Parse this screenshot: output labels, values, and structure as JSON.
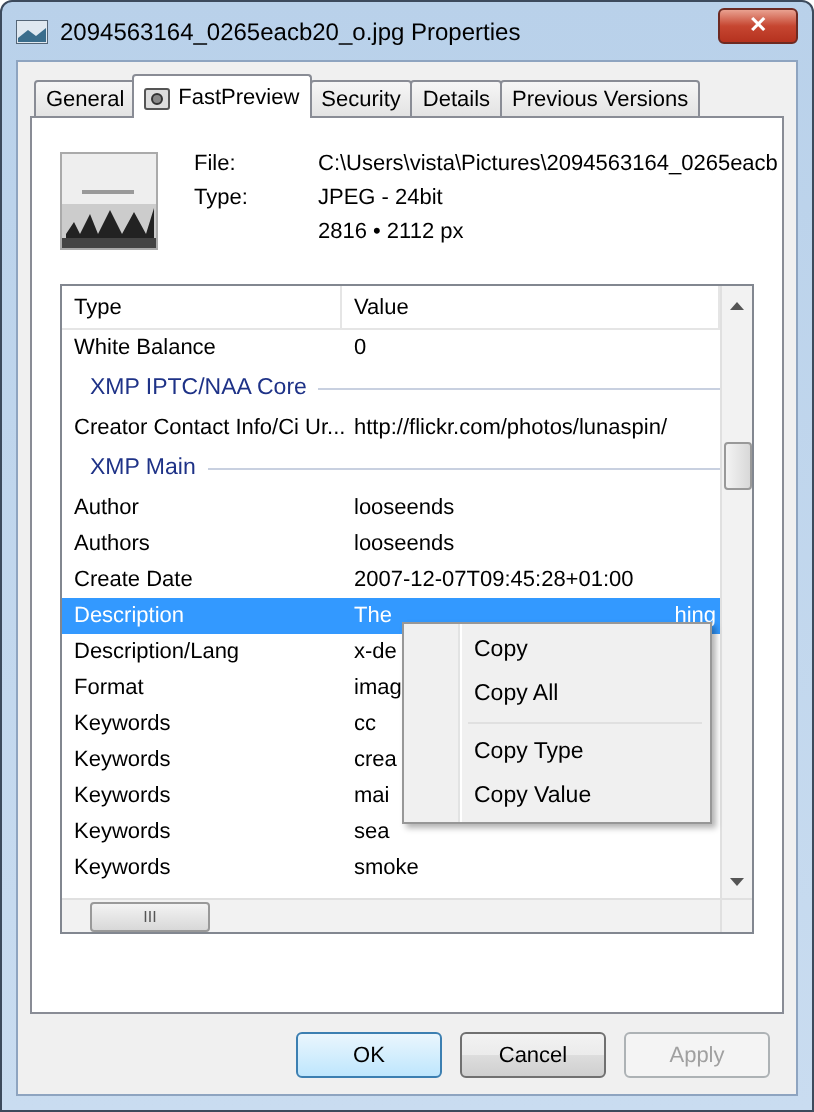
{
  "window": {
    "title": "2094563164_0265eacb20_o.jpg Properties",
    "close": "✕"
  },
  "tabs": [
    {
      "label": "General",
      "selected": false
    },
    {
      "label": "FastPreview",
      "selected": true,
      "icon": true
    },
    {
      "label": "Security",
      "selected": false
    },
    {
      "label": "Details",
      "selected": false
    },
    {
      "label": "Previous Versions",
      "selected": false
    }
  ],
  "file_info": [
    {
      "label": "File:",
      "value": "C:\\Users\\vista\\Pictures\\2094563164_0265eacb"
    },
    {
      "label": "Type:",
      "value": "JPEG - 24bit"
    },
    {
      "value": "2816 • 2112 px"
    }
  ],
  "table": {
    "columns": [
      "Type",
      "Value"
    ],
    "rows": [
      {
        "kind": "row",
        "type": "White Balance",
        "value": "0",
        "selected": false
      },
      {
        "kind": "group",
        "title": "XMP IPTC/NAA Core"
      },
      {
        "kind": "row",
        "type": "Creator Contact Info/Ci Ur...",
        "value": "http://flickr.com/photos/lunaspin/",
        "selected": false
      },
      {
        "kind": "group",
        "title": "XMP Main"
      },
      {
        "kind": "row",
        "type": "Author",
        "value": "looseends",
        "selected": false
      },
      {
        "kind": "row",
        "type": "Authors",
        "value": "looseends",
        "selected": false
      },
      {
        "kind": "row",
        "type": "Create Date",
        "value": "2007-12-07T09:45:28+01:00",
        "selected": false
      },
      {
        "kind": "row",
        "type": "Description",
        "value": "The",
        "value_tail": "hing",
        "selected": true
      },
      {
        "kind": "row",
        "type": "Description/Lang",
        "value": "x-de",
        "selected": false
      },
      {
        "kind": "row",
        "type": "Format",
        "value": "imag",
        "selected": false
      },
      {
        "kind": "row",
        "type": "Keywords",
        "value": "cc",
        "selected": false
      },
      {
        "kind": "row",
        "type": "Keywords",
        "value": "crea",
        "selected": false
      },
      {
        "kind": "row",
        "type": "Keywords",
        "value": "mai",
        "selected": false
      },
      {
        "kind": "row",
        "type": "Keywords",
        "value": "sea",
        "selected": false
      },
      {
        "kind": "row",
        "type": "Keywords",
        "value": "smoke",
        "selected": false
      }
    ],
    "hscroll_grip": "III"
  },
  "context_menu": [
    {
      "label": "Copy",
      "separator_before": false
    },
    {
      "label": "Copy All",
      "separator_before": false
    },
    {
      "label": "Copy Type",
      "separator_before": true
    },
    {
      "label": "Copy Value",
      "separator_before": false
    }
  ],
  "buttons": [
    {
      "label": "OK",
      "default": true,
      "disabled": false
    },
    {
      "label": "Cancel",
      "default": false,
      "disabled": false
    },
    {
      "label": "Apply",
      "default": false,
      "disabled": true
    }
  ]
}
